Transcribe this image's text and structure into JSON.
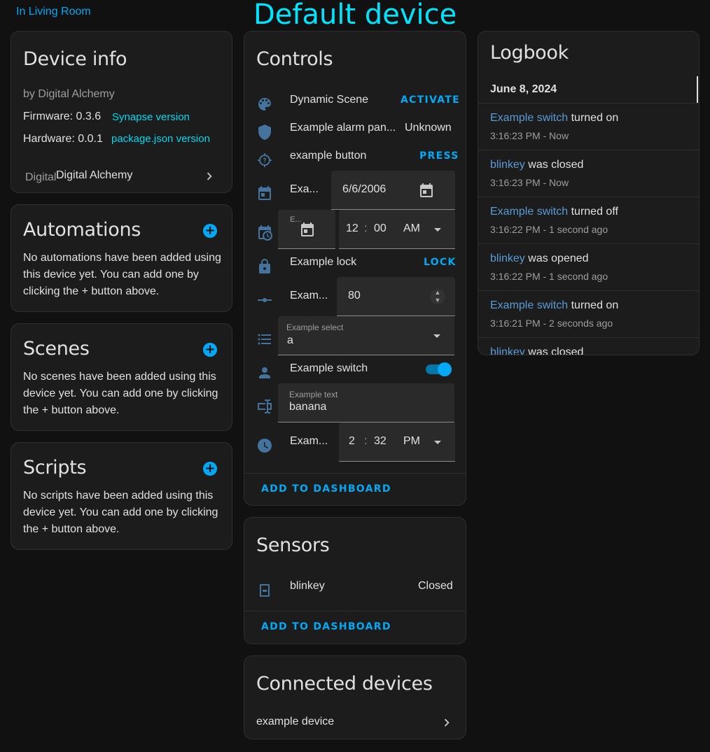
{
  "header": {
    "area_link": "In Living Room",
    "device_title": "Default device"
  },
  "device_info": {
    "title": "Device info",
    "manufacturer": "by Digital Alchemy",
    "firmware_label": "Firmware: 0.3.6",
    "firmware_link": "Synapse version",
    "hardware_label": "Hardware: 0.0.1",
    "hardware_link": "package.json version",
    "integration_overlap": "Digital",
    "integration_name": "Digital Alchemy"
  },
  "automations": {
    "title": "Automations",
    "body": "No automations have been added using this device yet. You can add one by clicking the + button above."
  },
  "scenes": {
    "title": "Scenes",
    "body": "No scenes have been added using this device yet. You can add one by clicking the + button above."
  },
  "scripts": {
    "title": "Scripts",
    "body": "No scripts have been added using this device yet. You can add one by clicking the + button above."
  },
  "controls": {
    "title": "Controls",
    "dynamic_scene": {
      "name": "Dynamic Scene",
      "action": "ACTIVATE"
    },
    "alarm": {
      "name": "Example alarm pan...",
      "state": "Unknown"
    },
    "button": {
      "name": "example button",
      "action": "PRESS"
    },
    "date": {
      "name": "Exa...",
      "value": "6/6/2006"
    },
    "datetime": {
      "name": "E...",
      "hour": "12",
      "minute": "00",
      "ampm": "AM",
      "sep": ":"
    },
    "lock": {
      "name": "Example lock",
      "action": "LOCK"
    },
    "number": {
      "name": "Exam...",
      "value": "80"
    },
    "select": {
      "label": "Example select",
      "value": "a"
    },
    "switch": {
      "name": "Example switch",
      "on": true
    },
    "text": {
      "label": "Example text",
      "value": "banana"
    },
    "time": {
      "name": "Exam...",
      "hour": "2",
      "minute": "32",
      "ampm": "PM",
      "sep": ":"
    },
    "add_to_dashboard": "ADD TO DASHBOARD"
  },
  "sensors": {
    "title": "Sensors",
    "blinkey": {
      "name": "blinkey",
      "state": "Closed"
    },
    "add_to_dashboard": "ADD TO DASHBOARD"
  },
  "connected_devices": {
    "title": "Connected devices",
    "item": "example device"
  },
  "logbook": {
    "title": "Logbook",
    "date": "June 8, 2024",
    "entries": [
      {
        "entity": "Example switch",
        "message": " turned on",
        "time": "3:16:23 PM - Now"
      },
      {
        "entity": "blinkey",
        "message": " was closed",
        "time": "3:16:23 PM - Now"
      },
      {
        "entity": "Example switch",
        "message": " turned off",
        "time": "3:16:22 PM - 1 second ago"
      },
      {
        "entity": "blinkey",
        "message": " was opened",
        "time": "3:16:22 PM - 1 second ago"
      },
      {
        "entity": "Example switch",
        "message": " turned on",
        "time": "3:16:21 PM - 2 seconds ago"
      },
      {
        "entity": "blinkey",
        "message": " was closed",
        "time": ""
      }
    ]
  },
  "colors": {
    "accent": "#03a9f4",
    "icon": "#44739e",
    "title": "#00e5ff",
    "background": "#111111",
    "card": "#1c1c1c"
  }
}
